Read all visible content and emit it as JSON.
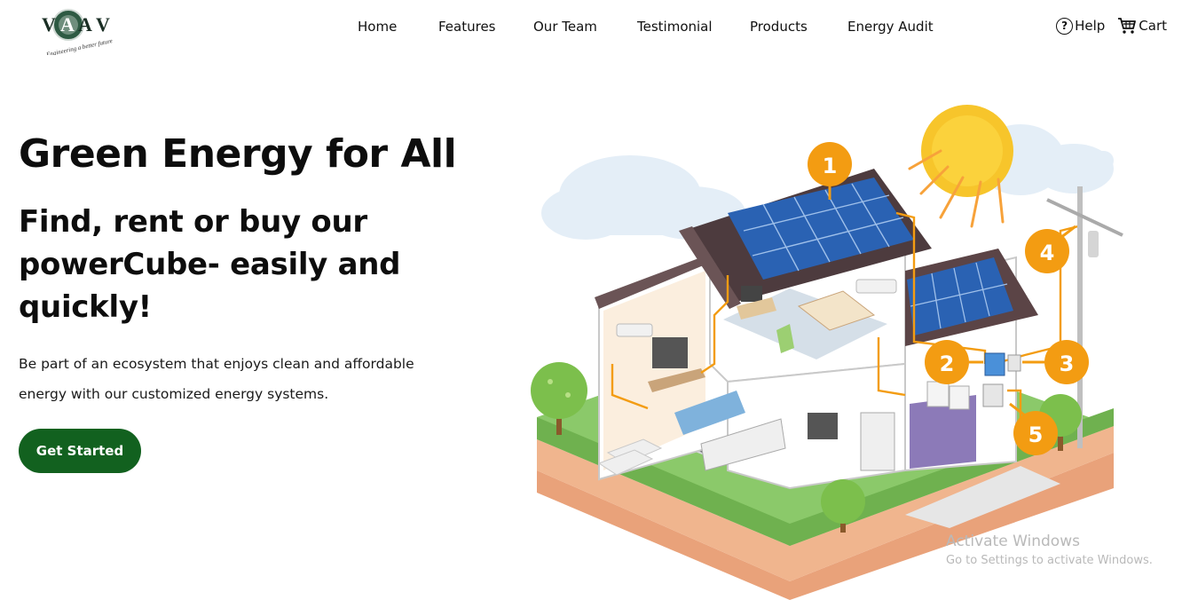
{
  "header": {
    "logo": {
      "text": "VAAV",
      "tagline": "...Engineering a better future"
    },
    "nav": [
      {
        "label": "Home"
      },
      {
        "label": "Features"
      },
      {
        "label": "Our Team"
      },
      {
        "label": "Testimonial"
      },
      {
        "label": "Products"
      },
      {
        "label": "Energy Audit"
      }
    ],
    "help_label": "Help",
    "cart_label": "Cart"
  },
  "hero": {
    "title": "Green Energy for All",
    "subtitle": "Find, rent or buy our powerCube- easily and quickly!",
    "description": "Be part of an ecosystem that enjoys clean and affordable energy with our customized energy systems.",
    "cta_label": "Get Started"
  },
  "illustration": {
    "markers": [
      "1",
      "2",
      "3",
      "4",
      "5"
    ]
  },
  "watermark": {
    "line1": "Activate Windows",
    "line2": "Go to Settings to activate Windows."
  },
  "colors": {
    "cta": "#12611f",
    "marker": "#f39c12",
    "solar_panel": "#1d5fb3",
    "roof": "#5b4446",
    "grass": "#8bc96a",
    "soil": "#e9a27a"
  }
}
